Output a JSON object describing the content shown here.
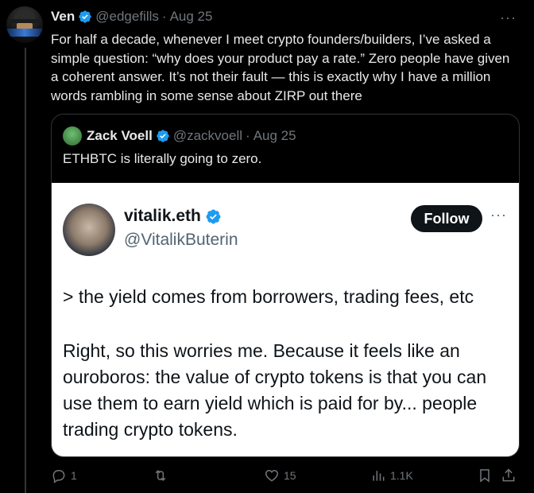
{
  "tweet": {
    "author_name": "Ven",
    "author_handle": "@edgefills",
    "separator": "·",
    "date": "Aug 25",
    "more": "···",
    "text": "For half a decade, whenever I meet crypto founders/builders, I’ve asked a simple question: “why does your product pay a rate.” Zero people have given a coherent answer. It’s not their fault — this is exactly why I have a million words rambling in some sense about ZIRP out there"
  },
  "quote": {
    "author_name": "Zack Voell",
    "author_handle": "@zackvoell",
    "separator": "·",
    "date": "Aug 25",
    "text": "ETHBTC is literally going to zero."
  },
  "embedded": {
    "name": "vitalik.eth",
    "handle": "@VitalikButerin",
    "follow_label": "Follow",
    "more": "···",
    "line1": "> the yield comes from borrowers, trading fees, etc",
    "paragraph": "Right, so this worries me. Because it feels like an ouroboros: the value of crypto tokens is that you can use them to earn yield which is paid for by... people trading crypto tokens."
  },
  "actions": {
    "replies": "1",
    "retweets": "",
    "likes": "15",
    "views": "1.1K"
  },
  "colors": {
    "background": "#000000",
    "verified": "#1d9bf0",
    "muted": "#71767b",
    "text": "#e7e9ea"
  }
}
